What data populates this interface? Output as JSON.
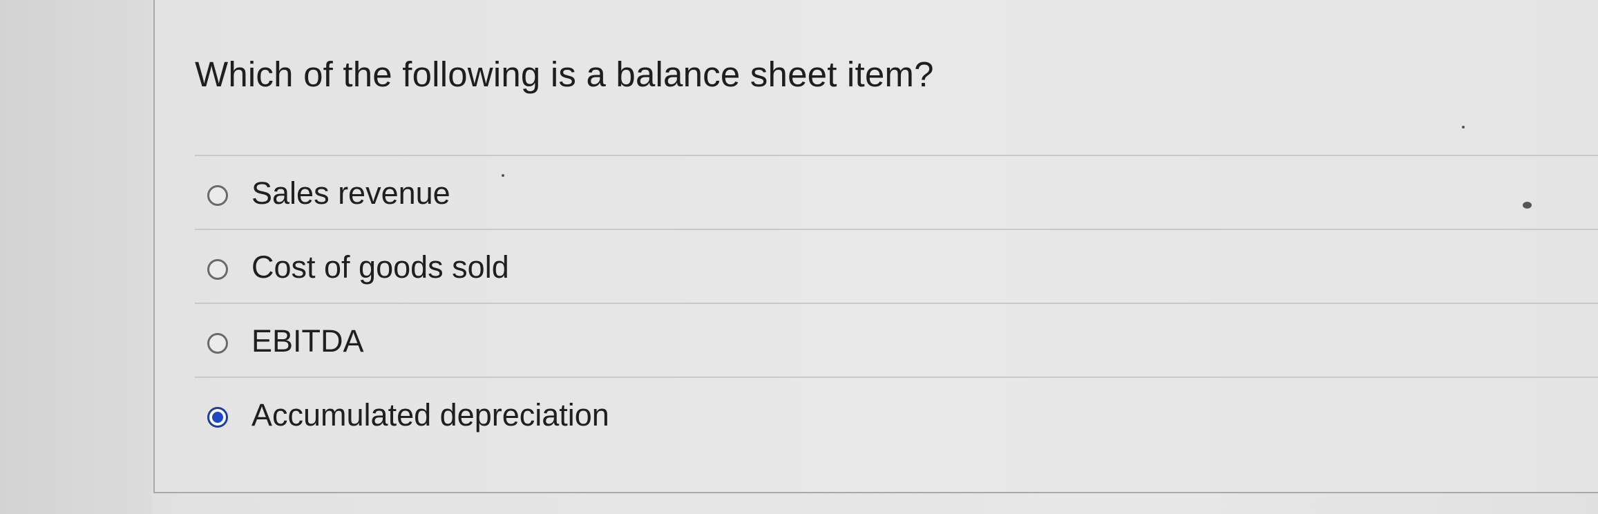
{
  "quiz": {
    "question": "Which of the following is a balance sheet item?",
    "options": [
      {
        "label": "Sales revenue",
        "selected": false
      },
      {
        "label": "Cost of goods sold",
        "selected": false
      },
      {
        "label": "EBITDA",
        "selected": false
      },
      {
        "label": "Accumulated depreciation",
        "selected": true
      }
    ]
  },
  "colors": {
    "selected_radio": "#1f48c7",
    "unselected_radio_border": "#6a6a6a",
    "text": "#1e1e1e",
    "divider": "#c9c9c9"
  }
}
